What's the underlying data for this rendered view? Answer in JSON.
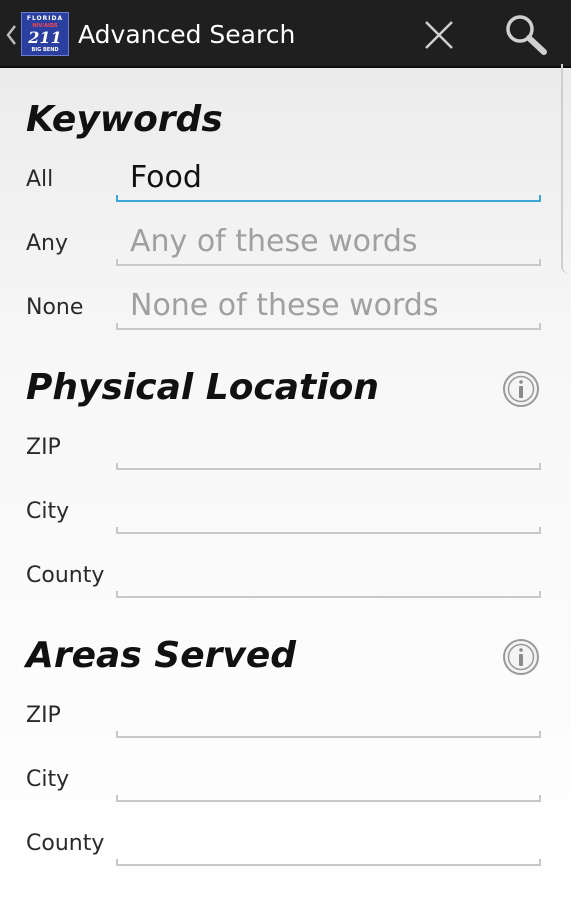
{
  "header": {
    "title": "Advanced Search",
    "logo_text": {
      "top": "FLORIDA",
      "middle": "HIV/AIDS",
      "number": "211",
      "bottom": "BIG BEND"
    },
    "background": "#1f1f1f"
  },
  "keywords": {
    "title": "Keywords",
    "fields": [
      {
        "label": "All",
        "value": "Food",
        "placeholder": ""
      },
      {
        "label": "Any",
        "value": "",
        "placeholder": "Any of these words"
      },
      {
        "label": "None",
        "value": "",
        "placeholder": "None of these words"
      }
    ]
  },
  "physical_location": {
    "title": "Physical Location",
    "fields": [
      {
        "label": "ZIP"
      },
      {
        "label": "City"
      },
      {
        "label": "County"
      }
    ]
  },
  "areas_served": {
    "title": "Areas Served",
    "fields": [
      {
        "label": "ZIP"
      },
      {
        "label": "City"
      },
      {
        "label": "County"
      }
    ]
  },
  "colors": {
    "accent": "#3aa8d8",
    "placeholder": "#a0a0a0",
    "underline": "#c8c8c8"
  }
}
